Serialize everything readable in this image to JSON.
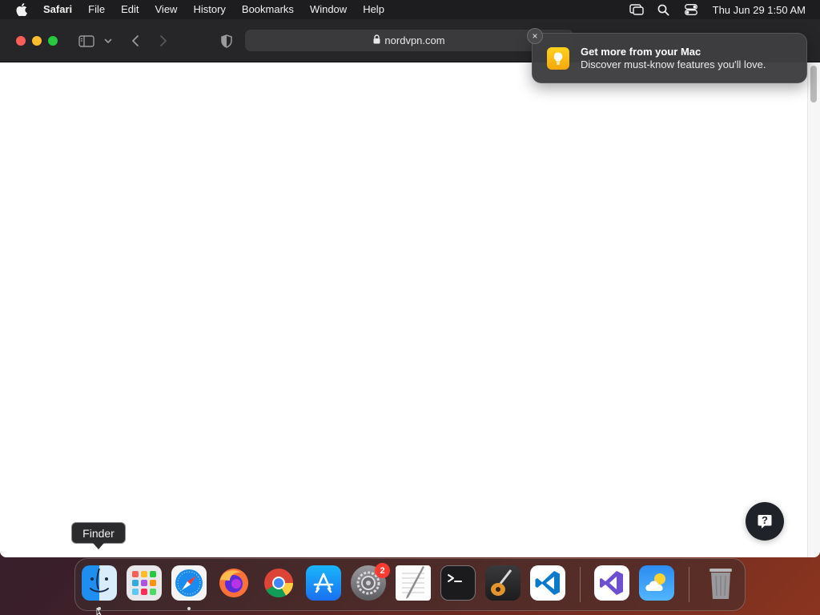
{
  "menubar": {
    "apple_icon": "apple-logo-icon",
    "app_name": "Safari",
    "items": [
      "File",
      "Edit",
      "View",
      "History",
      "Bookmarks",
      "Window",
      "Help"
    ],
    "status_icons": [
      "screen-mirroring-icon",
      "spotlight-search-icon",
      "control-center-icon"
    ],
    "clock": "Thu Jun 29  1:50 AM"
  },
  "safari": {
    "url": "nordvpn.com",
    "toolbar_icons": [
      "sidebar-icon",
      "chevron-down-icon",
      "back-icon",
      "forward-icon",
      "privacy-shield-icon",
      "lock-icon"
    ]
  },
  "notification": {
    "title": "Get more from your Mac",
    "body": "Discover must-know features you'll love.",
    "close_label": "×",
    "icon": "lightbulb-icon"
  },
  "page": {
    "help_button_label": "?"
  },
  "dock": {
    "tooltip": "Finder",
    "apps": [
      {
        "name": "Finder",
        "icon": "finder-icon",
        "running": true
      },
      {
        "name": "Launchpad",
        "icon": "launchpad-icon",
        "running": false
      },
      {
        "name": "Safari",
        "icon": "safari-icon",
        "running": true
      },
      {
        "name": "Firefox",
        "icon": "firefox-icon",
        "running": false
      },
      {
        "name": "Google Chrome",
        "icon": "chrome-icon",
        "running": false
      },
      {
        "name": "App Store",
        "icon": "app-store-icon",
        "running": false
      },
      {
        "name": "System Settings",
        "icon": "system-settings-icon",
        "running": false,
        "badge": "2"
      },
      {
        "name": "TextEdit",
        "icon": "textedit-icon",
        "running": false
      },
      {
        "name": "Terminal",
        "icon": "terminal-icon",
        "running": false
      },
      {
        "name": "GarageBand",
        "icon": "garageband-icon",
        "running": false
      },
      {
        "name": "Visual Studio Code",
        "icon": "vscode-icon",
        "running": false
      },
      {
        "name": "Visual Studio",
        "icon": "visual-studio-icon",
        "running": false
      },
      {
        "name": "Weather",
        "icon": "weather-icon",
        "running": false
      },
      {
        "name": "Trash",
        "icon": "trash-icon",
        "running": false
      }
    ]
  }
}
